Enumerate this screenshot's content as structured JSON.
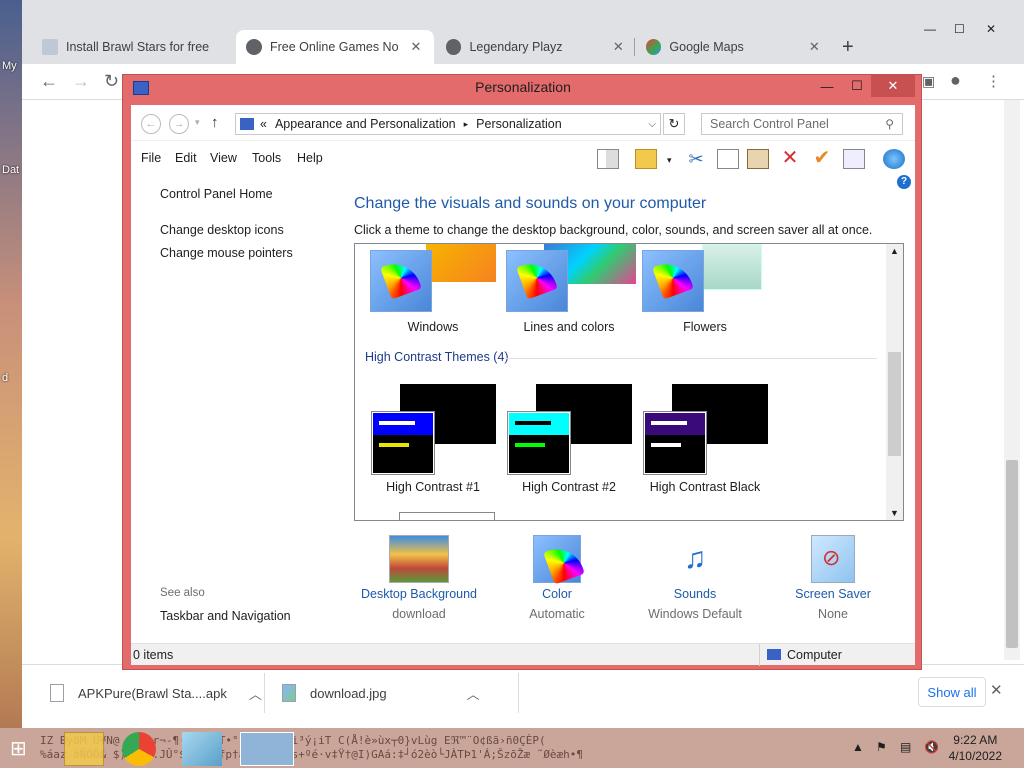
{
  "desktop": {
    "labels": [
      "My",
      "Dat",
      "d"
    ]
  },
  "chrome": {
    "tabs": [
      {
        "title": "Install Brawl Stars for free",
        "active": false
      },
      {
        "title": "Free Online Games No D",
        "active": true
      },
      {
        "title": "Legendary Playz",
        "active": false
      },
      {
        "title": "Google Maps",
        "active": false
      }
    ],
    "new_tab": "+",
    "window_controls": {
      "minimize": "—",
      "maximize": "☐",
      "close": "✕"
    }
  },
  "personalization": {
    "window_title": "Personalization",
    "breadcrumb": {
      "prefix": "«",
      "parent": "Appearance and Personalization",
      "separator": "▸",
      "current": "Personalization"
    },
    "search_placeholder": "Search Control Panel",
    "menu": [
      "File",
      "Edit",
      "View",
      "Tools",
      "Help"
    ],
    "left_links": {
      "home": "Control Panel Home",
      "desktop_icons": "Change desktop icons",
      "mouse_pointers": "Change mouse pointers",
      "see_also": "See also",
      "taskbar": "Taskbar and Navigation"
    },
    "heading": "Change the visuals and sounds on your computer",
    "subtitle": "Click a theme to change the desktop background, color, sounds, and screen saver all at once.",
    "themes": [
      "Windows",
      "Lines and colors",
      "Flowers"
    ],
    "hc_group": "High Contrast Themes (4)",
    "hc_themes": [
      {
        "name": "High Contrast #1",
        "bar": "#0000ff",
        "line2": "#e6e600"
      },
      {
        "name": "High Contrast #2",
        "bar": "#00ffff",
        "line2": "#00ff00"
      },
      {
        "name": "High Contrast Black",
        "bar": "#3a0a7a",
        "line2": "#ffffff"
      }
    ],
    "bottom": [
      {
        "label": "Desktop Background",
        "sub": "download"
      },
      {
        "label": "Color",
        "sub": "Automatic"
      },
      {
        "label": "Sounds",
        "sub": "Windows Default"
      },
      {
        "label": "Screen Saver",
        "sub": "None"
      }
    ],
    "status_items": "0 items",
    "status_location": "Computer"
  },
  "downloads": {
    "items": [
      "APKPure(Brawl Sta....apk",
      "download.jpg"
    ],
    "show_all": "Show all"
  },
  "taskbar": {
    "noise": "IZ ByöM Ü¥N@  ±G   ¤r¬-¶·mÜ±«ŒT•°:~_S¶òøÕi³ý¡iT C(Å!è»ùx┬0}vLùg Eℜ™¨O¢ßã›ñ0ÇÈP(",
    "noise2": "%áaz âÑÒÕ&  $)ÄXOY.JÛ°$   JLÕãfp†ãZÃÔ¢fbès+ºé·v‡Ÿ†@I)GAá:‡┘ó2èò└JÀTÞ1'Á;ŠzõŽæ ˜Øèæh•¶",
    "time": "9:22 AM",
    "date": "4/10/2022"
  }
}
